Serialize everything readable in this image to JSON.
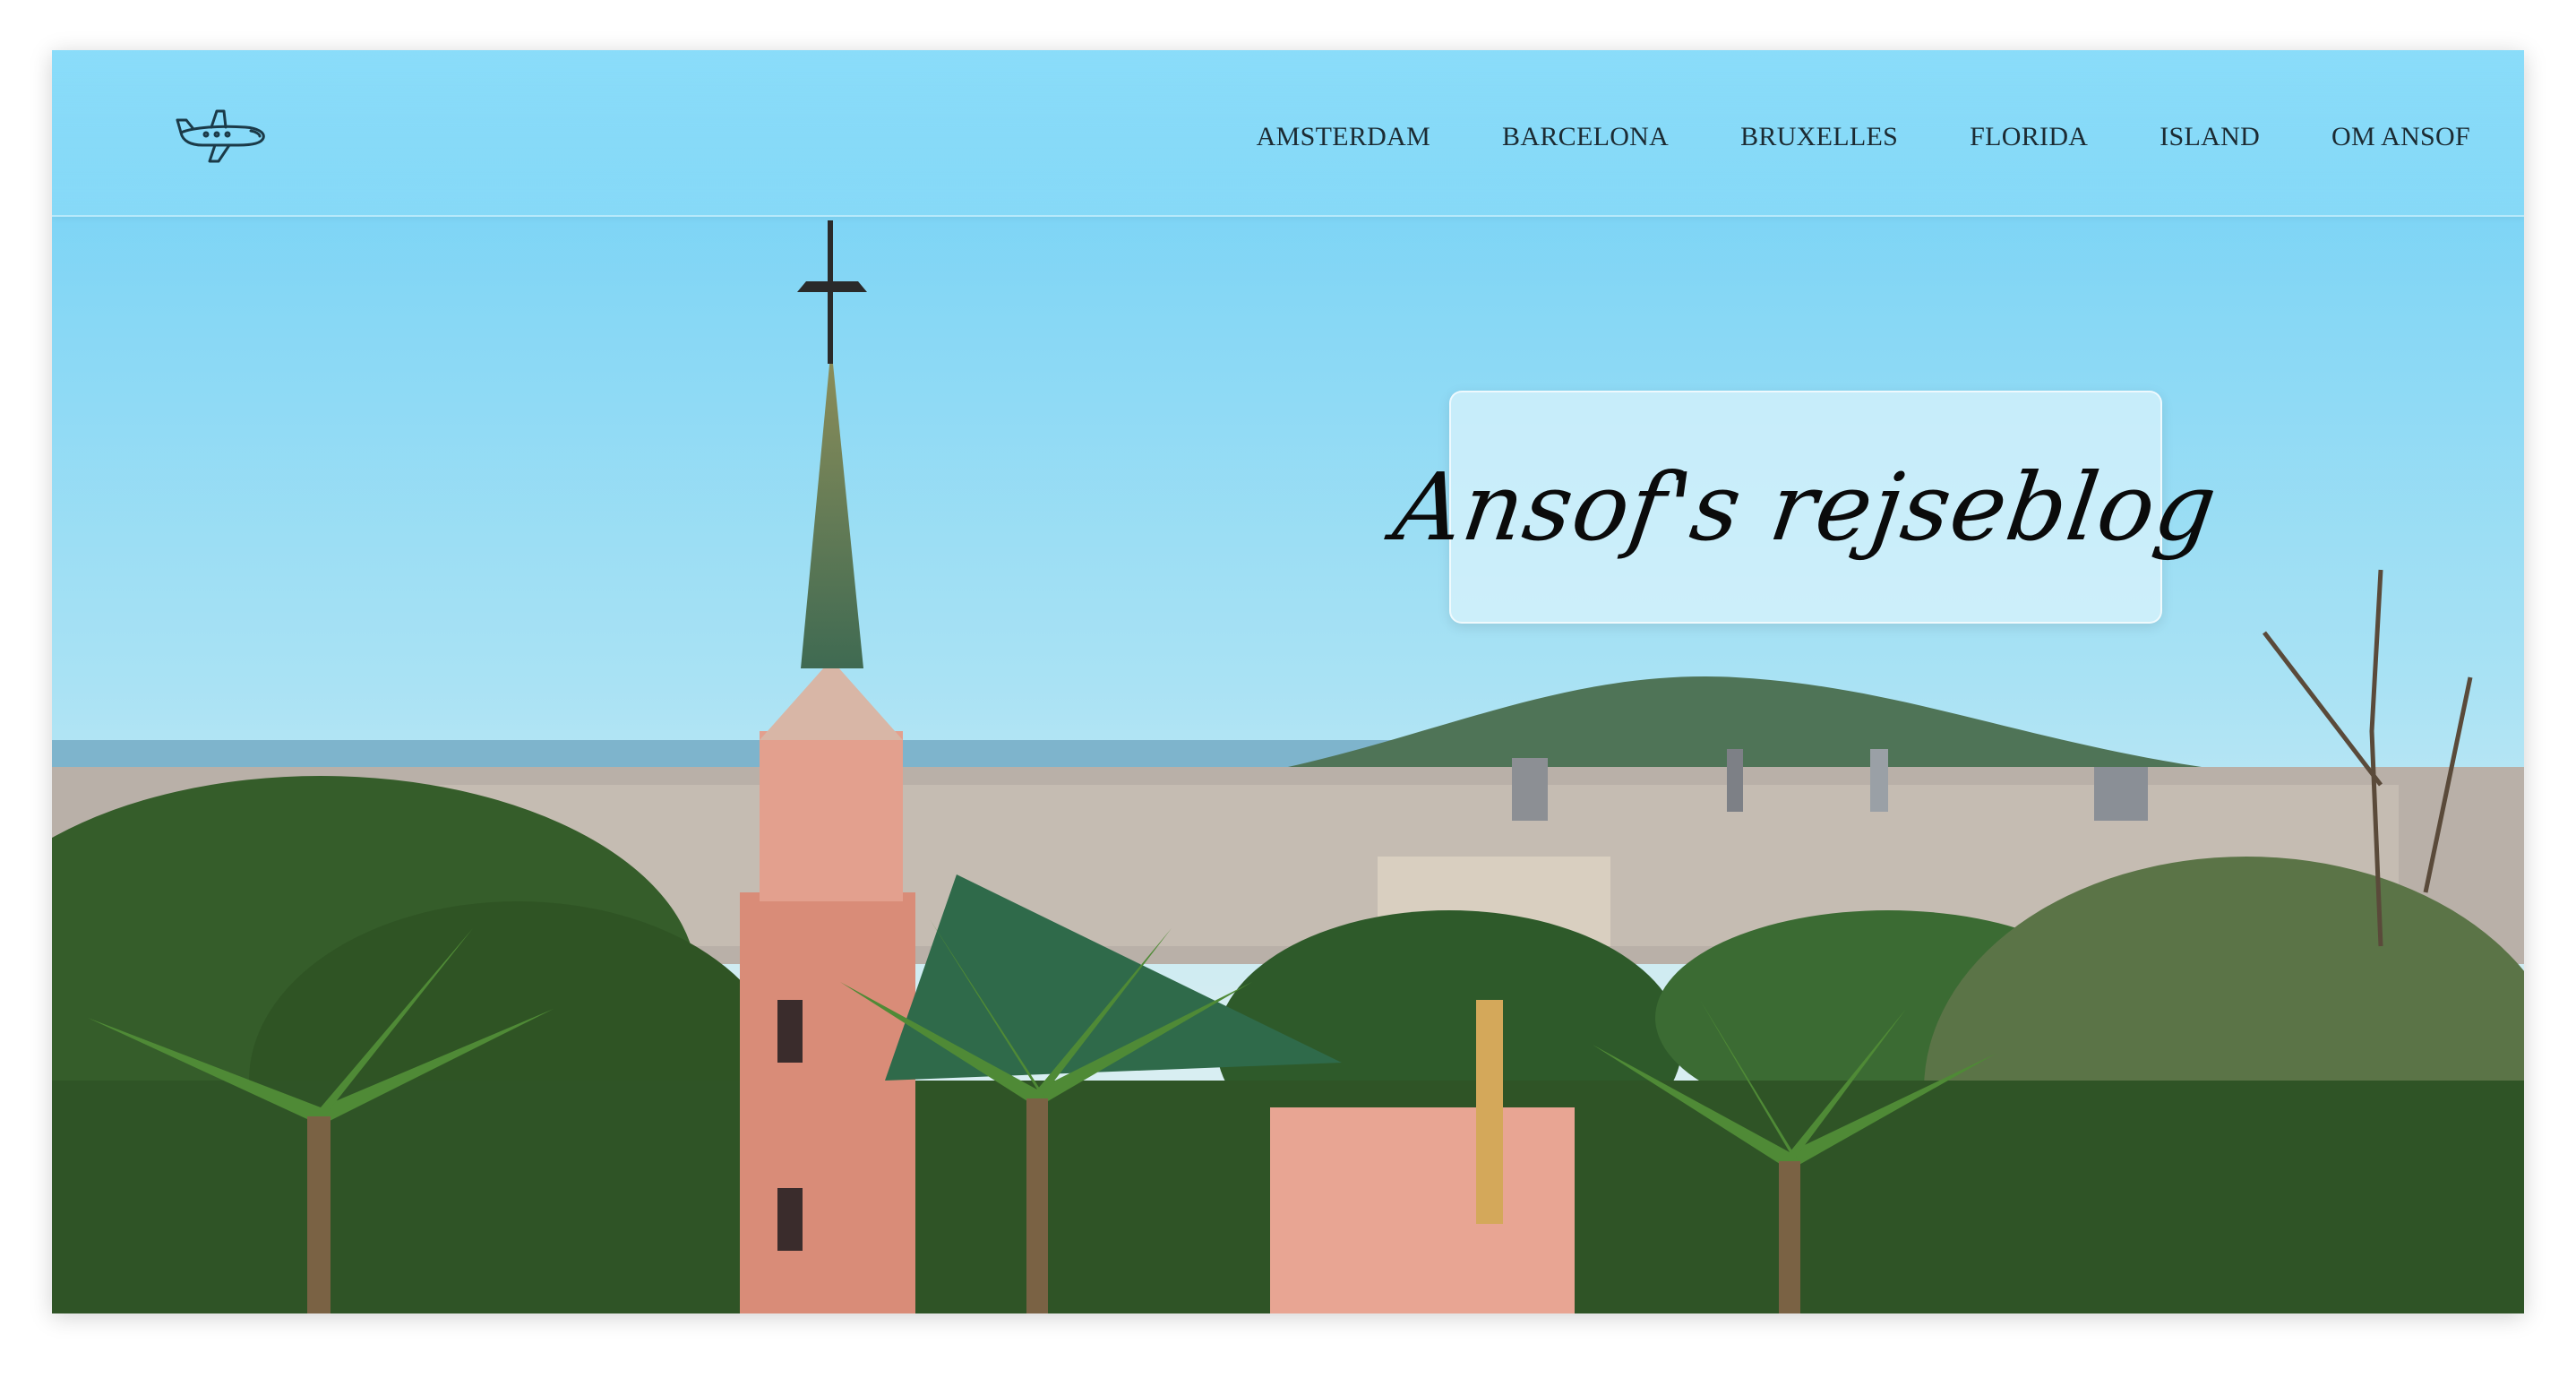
{
  "site": {
    "title": "Ansof's rejseblog",
    "logo_icon": "airplane-icon"
  },
  "nav": {
    "items": [
      {
        "label": "AMSTERDAM"
      },
      {
        "label": "BARCELONA"
      },
      {
        "label": "BRUXELLES"
      },
      {
        "label": "FLORIDA"
      },
      {
        "label": "ISLAND"
      },
      {
        "label": "OM ANSOF"
      }
    ]
  },
  "hero": {
    "image": "barcelona-park-guell-panorama"
  },
  "colors": {
    "sky": "#8fd8f3",
    "nav_text": "#1c2b33",
    "title_text": "#0b0b0b"
  }
}
